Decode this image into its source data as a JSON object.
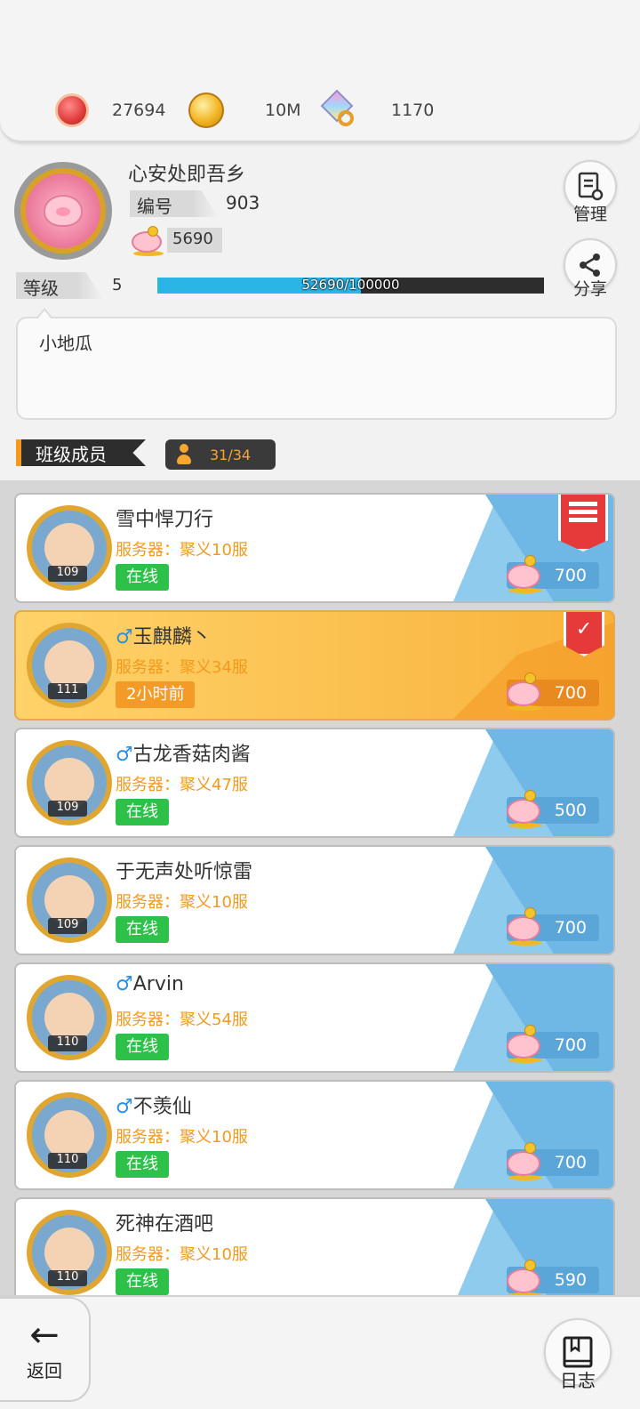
{
  "currencies": [
    {
      "icon": "ruby-coin-icon",
      "value": "27694"
    },
    {
      "icon": "gold-coin-icon",
      "value": "10M"
    },
    {
      "icon": "gem-ring-icon",
      "value": "1170"
    }
  ],
  "profile": {
    "name": "心安处即吾乡",
    "id_label": "编号",
    "id_value": "903",
    "piggy_value": "5690",
    "level_label": "等级",
    "level_value": "5",
    "exp_text": "52690/100000",
    "exp_fraction": 0.5269,
    "manage_label": "管理",
    "share_label": "分享",
    "motto": "小地瓜"
  },
  "section": {
    "title": "班级成员",
    "count": "31/34"
  },
  "members": [
    {
      "name": "雪中悍刀行",
      "gender": "",
      "server": "服务器：聚义10服",
      "status": "在线",
      "online": true,
      "level": "109",
      "score": "700",
      "badge": "leader",
      "highlight": false
    },
    {
      "name": "玉麒麟丶",
      "gender": "♂",
      "server": "服务器：聚义34服",
      "status": "2小时前",
      "online": false,
      "level": "111",
      "score": "700",
      "badge": "vice",
      "highlight": true
    },
    {
      "name": "古龙香菇肉酱",
      "gender": "♂",
      "server": "服务器：聚义47服",
      "status": "在线",
      "online": true,
      "level": "109",
      "score": "500",
      "badge": "",
      "highlight": false
    },
    {
      "name": "于无声处听惊雷",
      "gender": "",
      "server": "服务器：聚义10服",
      "status": "在线",
      "online": true,
      "level": "109",
      "score": "700",
      "badge": "",
      "highlight": false
    },
    {
      "name": "Arvin",
      "gender": "♂",
      "server": "服务器：聚义54服",
      "status": "在线",
      "online": true,
      "level": "110",
      "score": "700",
      "badge": "",
      "highlight": false
    },
    {
      "name": "不羡仙",
      "gender": "♂",
      "server": "服务器：聚义10服",
      "status": "在线",
      "online": true,
      "level": "110",
      "score": "700",
      "badge": "",
      "highlight": false
    },
    {
      "name": "死神在酒吧",
      "gender": "",
      "server": "服务器：聚义10服",
      "status": "在线",
      "online": true,
      "level": "110",
      "score": "590",
      "badge": "",
      "highlight": false
    }
  ],
  "bottom": {
    "back_label": "返回",
    "log_label": "日志"
  }
}
